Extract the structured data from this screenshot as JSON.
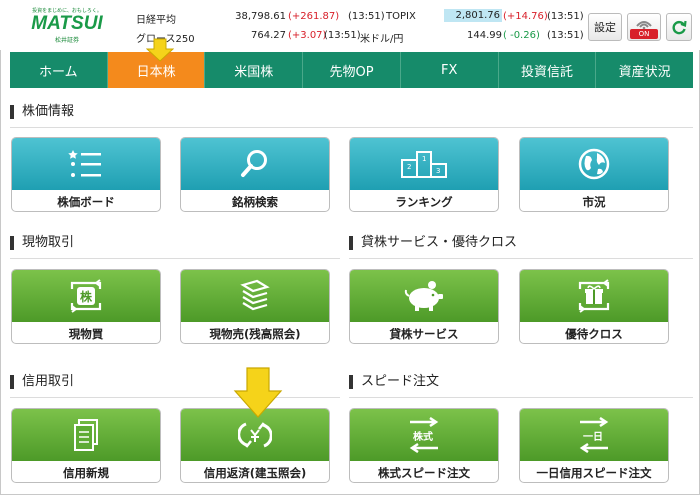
{
  "brand": {
    "tagline": "投資をまじめに、おもしろく。",
    "name": "MATSUI",
    "sub": "松井証券"
  },
  "tickers": [
    {
      "name": "日経平均",
      "value": "38,798.61",
      "change": "(+261.87)",
      "time": "(13:51)"
    },
    {
      "name": "グロース250",
      "value": "764.27",
      "change": "(+3.07)",
      "time": "(13:51)"
    },
    {
      "name": "TOPIX",
      "value": "2,801.76",
      "change": "(+14.76)",
      "time": "(13:51)"
    },
    {
      "name": "米ドル/円",
      "value": "144.99",
      "change": "( -0.26)",
      "time": "(13:51)"
    }
  ],
  "header_buttons": {
    "settings": "設定",
    "on_badge": "ON"
  },
  "nav": [
    {
      "label": "ホーム"
    },
    {
      "label": "日本株"
    },
    {
      "label": "米国株"
    },
    {
      "label": "先物OP"
    },
    {
      "label": "FX"
    },
    {
      "label": "投資信託"
    },
    {
      "label": "資産状況"
    }
  ],
  "sections": {
    "stock_info": "株価情報",
    "cash_trading": "現物取引",
    "lending": "貸株サービス・優待クロス",
    "margin": "信用取引",
    "speed": "スピード注文"
  },
  "tiles": {
    "stock_board": "株価ボード",
    "stock_search": "銘柄検索",
    "ranking": "ランキング",
    "market": "市況",
    "cash_buy": "現物買",
    "cash_sell": "現物売(残高照会)",
    "lending_service": "貸株サービス",
    "benefit_cross": "優待クロス",
    "margin_new": "信用新規",
    "margin_repay": "信用返済(建玉照会)",
    "stock_speed": "株式スピード注文",
    "day_margin_speed": "一日信用スピード注文"
  },
  "icon_text": {
    "kabu": "株",
    "kabushiki": "株式",
    "ichinichi": "一日"
  },
  "colors": {
    "nav": "#168b6a",
    "nav_active": "#f48a1c",
    "teal": "#2aa9bb",
    "green": "#5eab34",
    "up": "#d8202a",
    "down": "#1a9a48",
    "arrow": "#f5d31a"
  }
}
